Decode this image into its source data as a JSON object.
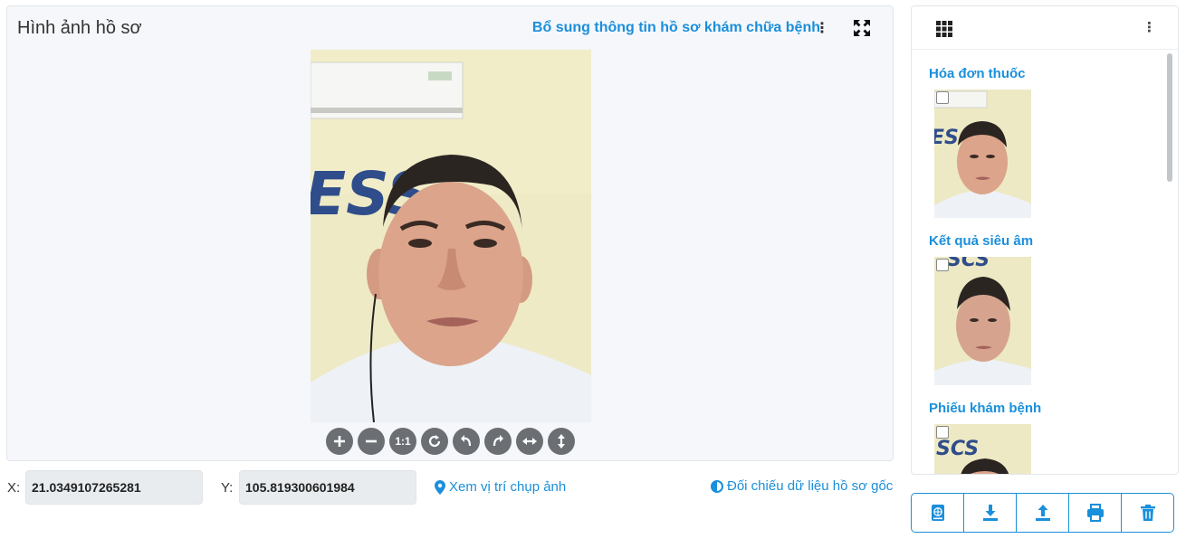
{
  "viewer": {
    "title": "Hình ảnh hồ sơ",
    "supplement_link": "Bổ sung thông tin hồ sơ khám chữa bệnh",
    "kebab": "⋮",
    "photo_caption_logo": "ESS",
    "toolbar": [
      {
        "name": "zoom-in-button",
        "icon": "plus-icon"
      },
      {
        "name": "zoom-out-button",
        "icon": "minus-icon"
      },
      {
        "name": "actual-size-button",
        "icon": "one-to-one-icon",
        "text": "1:1"
      },
      {
        "name": "reset-button",
        "icon": "refresh-icon"
      },
      {
        "name": "rotate-left-button",
        "icon": "rotate-left-icon"
      },
      {
        "name": "rotate-right-button",
        "icon": "rotate-right-icon"
      },
      {
        "name": "flip-horizontal-button",
        "icon": "flip-horizontal-icon"
      },
      {
        "name": "flip-vertical-button",
        "icon": "flip-vertical-icon"
      }
    ]
  },
  "coords": {
    "x_label": "X:",
    "x_value": "21.0349107265281",
    "y_label": "Y:",
    "y_value": "105.819300601984",
    "location_link": "Xem vị trí chụp ảnh",
    "compare_link": "Đối chiếu dữ liệu hồ sơ gốc"
  },
  "side": {
    "kebab": "⋮",
    "groups": [
      {
        "title": "Hóa đơn thuốc",
        "logo": "ES"
      },
      {
        "title": "Kết quả siêu âm",
        "logo": "SCS"
      },
      {
        "title": "Phiếu khám bệnh",
        "logo": "SCS"
      }
    ]
  },
  "actions": [
    {
      "name": "globe-book-button",
      "icon": "globe-book-icon"
    },
    {
      "name": "download-button",
      "icon": "download-icon"
    },
    {
      "name": "upload-button",
      "icon": "upload-icon"
    },
    {
      "name": "print-button",
      "icon": "print-icon"
    },
    {
      "name": "delete-button",
      "icon": "trash-icon"
    }
  ],
  "colors": {
    "accent": "#1a8fdb",
    "tool_button": "#6b6f73",
    "photo_wall": "#eeeac6",
    "logo_blue": "#2f4d8a"
  }
}
